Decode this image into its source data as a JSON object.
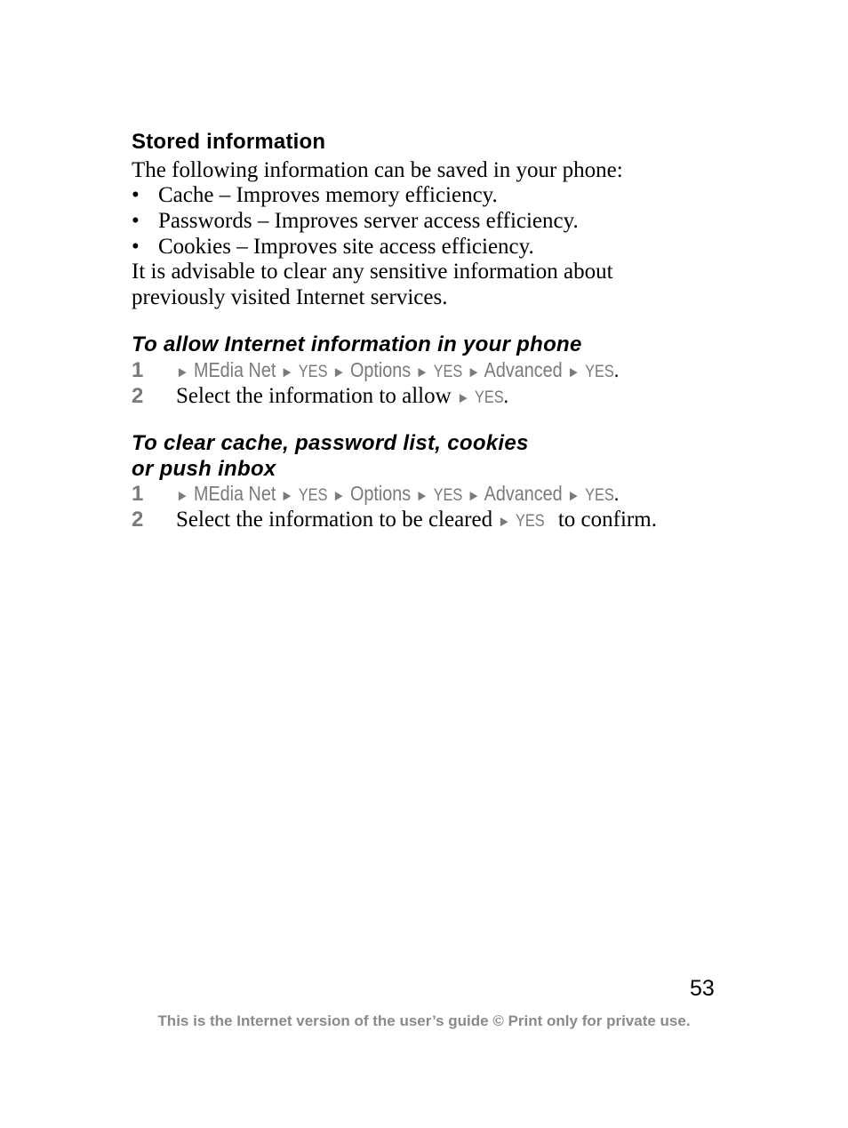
{
  "section_stored": {
    "heading": "Stored information",
    "intro": "The following information can be saved in your phone:",
    "bullets": [
      {
        "bullet": "•",
        "text": "Cache – Improves memory efficiency."
      },
      {
        "bullet": "•",
        "text": "Passwords – Improves server access efficiency."
      },
      {
        "bullet": "•",
        "text": "Cookies – Improves site access efficiency."
      }
    ],
    "advice_line1": "It is advisable to clear any sensitive information about",
    "advice_line2": "previously visited Internet services."
  },
  "section_allow": {
    "heading": "To allow Internet information in your phone",
    "steps": [
      {
        "number": "1",
        "path": {
          "arrow": "►",
          "item1": "MEdia Net",
          "yes": "YES",
          "item2": "Options",
          "item3": "Advanced",
          "end": "."
        }
      },
      {
        "number": "2",
        "text": "Select the information to allow",
        "arrow": "►",
        "yes": "YES",
        "end": "."
      }
    ]
  },
  "section_clear": {
    "heading_line1": "To clear cache, password list, cookies",
    "heading_line2": "or push inbox",
    "steps": [
      {
        "number": "1",
        "path": {
          "arrow": "►",
          "item1": "MEdia Net",
          "yes": "YES",
          "item2": "Options",
          "item3": "Advanced",
          "end": "."
        }
      },
      {
        "number": "2",
        "text": "Select the information to be cleared",
        "arrow": "►",
        "yes": "YES",
        "end": " to confirm."
      }
    ]
  },
  "page_number": "53",
  "footer": "This is the Internet version of the user’s guide © Print only for private use.",
  "colors": {
    "text": "#000000",
    "menu_grey": "#7a7a7a",
    "footer_grey": "#8a8a8a",
    "background": "#ffffff"
  }
}
